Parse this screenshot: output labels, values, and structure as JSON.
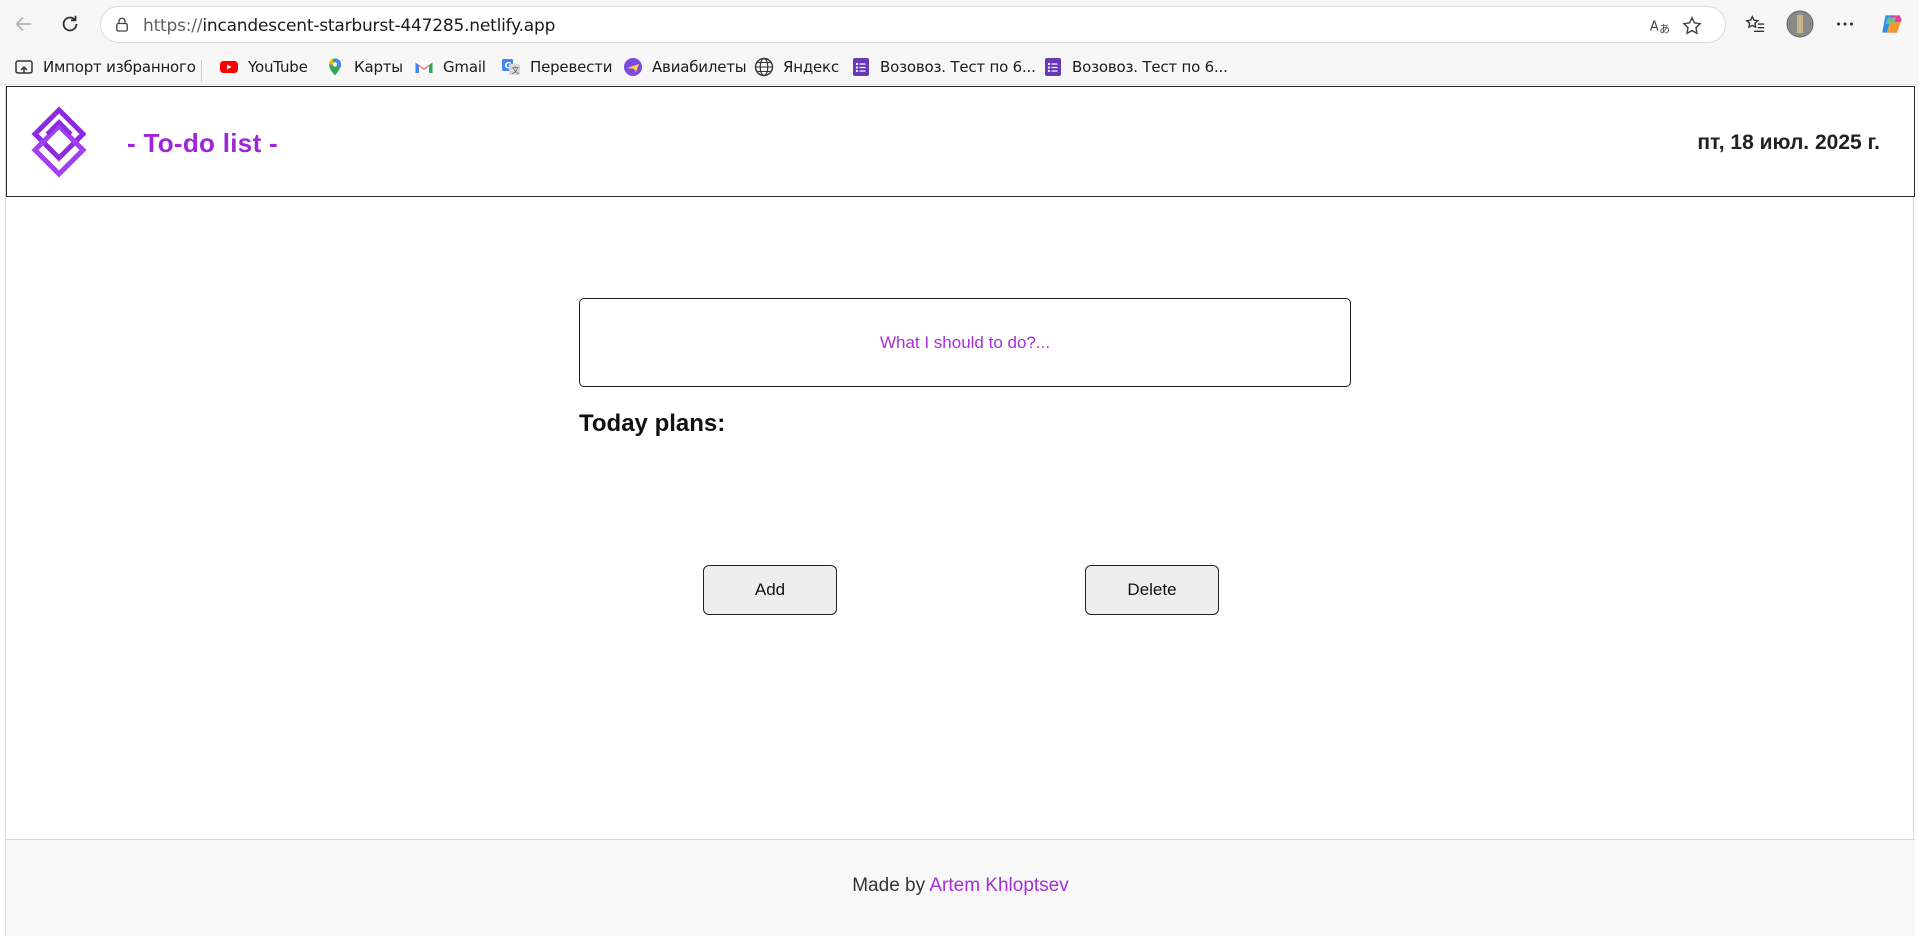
{
  "browser": {
    "url_protocol": "https://",
    "url_host": "incandescent-starburst-447285.netlify.app",
    "bookmarks": [
      {
        "label": "Импорт избранного",
        "icon": "import-favorites-icon"
      },
      {
        "label": "YouTube",
        "icon": "youtube-icon"
      },
      {
        "label": "Карты",
        "icon": "maps-pin-icon"
      },
      {
        "label": "Gmail",
        "icon": "gmail-icon"
      },
      {
        "label": "Перевести",
        "icon": "translate-icon"
      },
      {
        "label": "Авиабилеты",
        "icon": "flights-icon"
      },
      {
        "label": "Яндекс",
        "icon": "globe-icon"
      },
      {
        "label": "Возовоз. Тест по 6...",
        "icon": "forms-list-icon"
      },
      {
        "label": "Возовоз. Тест по 6...",
        "icon": "forms-list-icon"
      }
    ]
  },
  "header": {
    "title": "- To-do list -",
    "date": "пт, 18 июл. 2025 г."
  },
  "todo": {
    "input_placeholder": "What I should to do?...",
    "input_value": "",
    "plans_title": "Today plans:",
    "items": []
  },
  "buttons": {
    "add_label": "Add",
    "delete_label": "Delete"
  },
  "footer": {
    "prefix": "Made by ",
    "author": "Artem Khloptsev"
  },
  "colors": {
    "accent": "#9d27d6",
    "link": "#a52fd8",
    "border": "#1e1e1e"
  }
}
